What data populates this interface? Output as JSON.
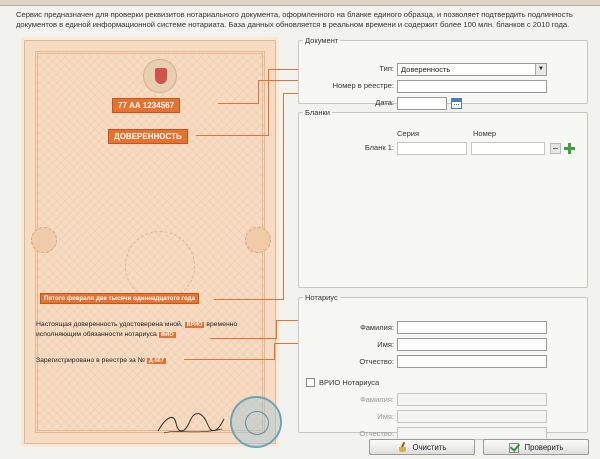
{
  "intro_text": "Сервис предназначен для проверки реквизитов нотариального документа, оформленного на бланке единого образца, и позволяет подтвердить подлинность документов в единой информационной системе нотариата. База данных обновляется в реальном времени и содержит более 100 млн. бланков с 2010 года.",
  "document_image": {
    "blank_number": "77 АА 1234567",
    "doc_type": "ДОВЕРЕННОСТЬ",
    "date_text": "Пятого февраля две тысячи одиннадцатого года",
    "cert_text_1": "Настоящая доверенность удостоверена мной,",
    "cert_tag_vrio": "ВРИО",
    "cert_text_2": "временно",
    "cert_text_3": "исполняющим обязанности нотариуса",
    "cert_tag_2": "ФИО",
    "registry_text": "Зарегистрировано в реестре за №",
    "registry_tag": "Д-567"
  },
  "document_section": {
    "legend": "Документ",
    "type_label": "Тип:",
    "type_value": "Доверенность",
    "registry_label": "Номер в реестре:",
    "registry_value": "",
    "date_label": "Дата:",
    "date_value": ""
  },
  "blanks_section": {
    "legend": "Бланки",
    "series_header": "Серия",
    "number_header": "Номер",
    "blank_label": "Бланк 1:",
    "series_value": "",
    "number_value": ""
  },
  "notary_section": {
    "legend": "Нотариус",
    "surname_label": "Фамилия:",
    "name_label": "Имя:",
    "patronymic_label": "Отчество:",
    "vrio_label": "ВРИО Нотариуса",
    "vrio_checked": false,
    "vrio_surname_label": "Фамилия:",
    "vrio_name_label": "Имя:",
    "vrio_patronymic_label": "Отчество:"
  },
  "buttons": {
    "clear": "Очистить",
    "check": "Проверить"
  },
  "colors": {
    "accent_orange": "#e8712f",
    "paper": "#f6dcc3",
    "add_green": "#3aa33a"
  }
}
